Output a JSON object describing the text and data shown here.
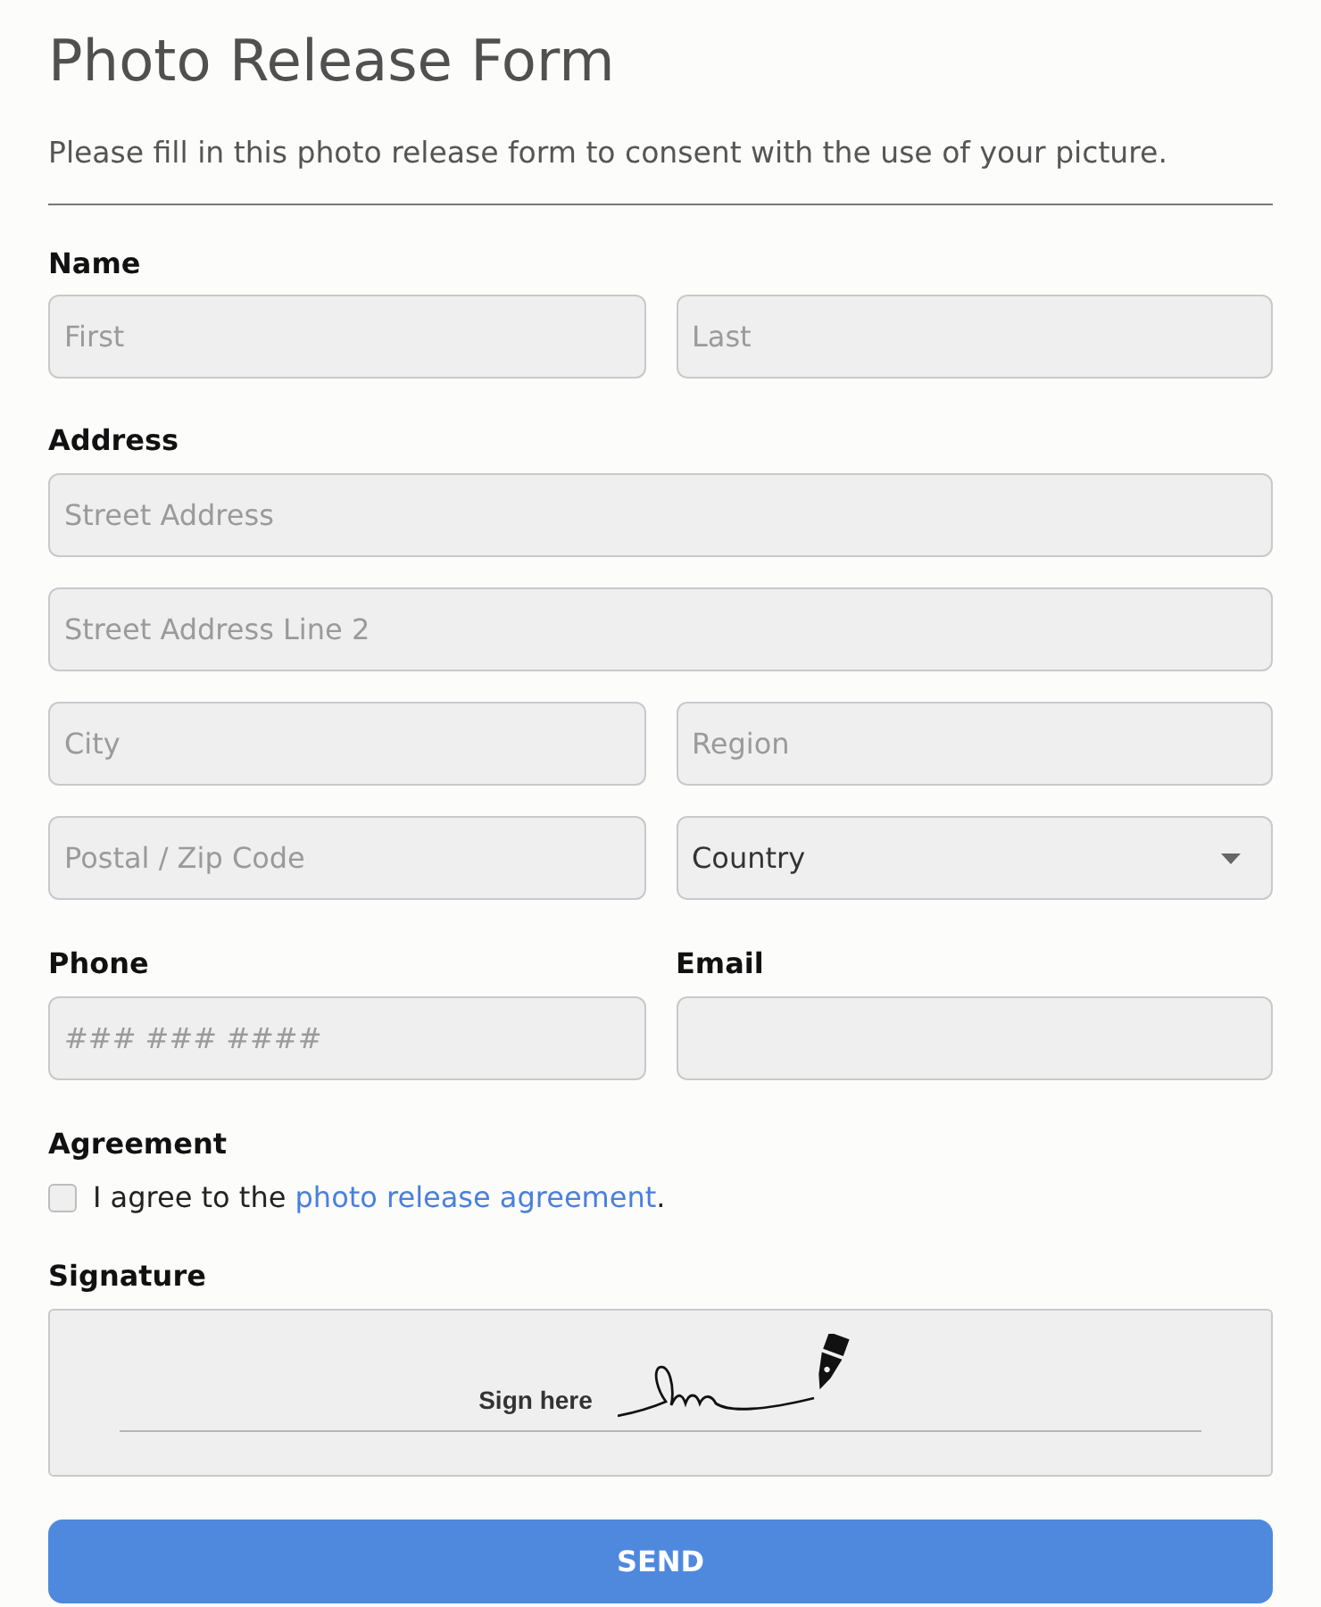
{
  "title": "Photo Release Form",
  "description": "Please fill in this photo release form to consent with the use of your picture.",
  "name": {
    "label": "Name",
    "fields": [
      {
        "kind": "text",
        "placeholder": "First"
      },
      {
        "kind": "text",
        "placeholder": "Last"
      }
    ]
  },
  "address": {
    "label": "Address",
    "rows": [
      [
        {
          "kind": "text",
          "placeholder": "Street Address"
        }
      ],
      [
        {
          "kind": "text",
          "placeholder": "Street Address Line 2"
        }
      ],
      [
        {
          "kind": "text",
          "placeholder": "City"
        },
        {
          "kind": "text",
          "placeholder": "Region"
        }
      ],
      [
        {
          "kind": "text",
          "placeholder": "Postal / Zip Code"
        },
        {
          "kind": "select",
          "value": "Country"
        }
      ]
    ]
  },
  "contact": [
    {
      "label": "Phone",
      "field": {
        "kind": "text",
        "placeholder": "### ### ####"
      }
    },
    {
      "label": "Email",
      "field": {
        "kind": "text"
      }
    }
  ],
  "agreement": {
    "label": "Agreement",
    "checked": false,
    "text": "I agree to the ",
    "link": "photo release agreement",
    "suffix": "."
  },
  "signature": {
    "label": "Signature",
    "hint": "Sign here"
  },
  "submit": {
    "label": "SEND"
  }
}
